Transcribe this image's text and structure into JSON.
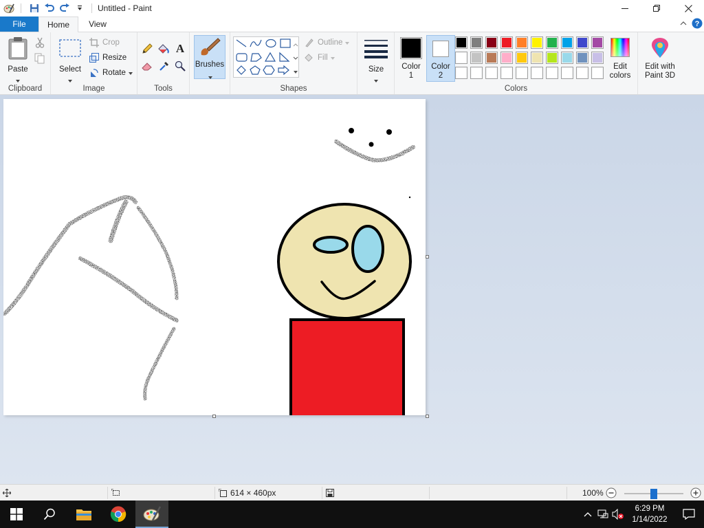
{
  "window": {
    "title": "Untitled - Paint"
  },
  "tabs": {
    "file": "File",
    "home": "Home",
    "view": "View"
  },
  "clipboard": {
    "paste": "Paste",
    "label": "Clipboard"
  },
  "image": {
    "select": "Select",
    "crop": "Crop",
    "resize": "Resize",
    "rotate": "Rotate",
    "label": "Image"
  },
  "tools": {
    "label": "Tools",
    "brushes": "Brushes"
  },
  "shapes": {
    "outline": "Outline",
    "fill": "Fill",
    "label": "Shapes"
  },
  "size": {
    "label": "Size"
  },
  "colors": {
    "color1_label": "Color",
    "color1_num": "1",
    "color2_label": "Color",
    "color2_num": "2",
    "color1_value": "#000000",
    "color2_value": "#ffffff",
    "edit_colors_line1": "Edit",
    "edit_colors_line2": "colors",
    "edit_paint3d_line1": "Edit with",
    "edit_paint3d_line2": "Paint 3D",
    "label": "Colors",
    "palette_row1": [
      "#000000",
      "#7f7f7f",
      "#880015",
      "#ed1c24",
      "#ff7f27",
      "#fff200",
      "#22b14c",
      "#00a2e8",
      "#3f48cc",
      "#a349a4"
    ],
    "palette_row2": [
      "#ffffff",
      "#c3c3c3",
      "#b97a57",
      "#ffaec9",
      "#ffc90e",
      "#efe4b0",
      "#b5e61d",
      "#99d9ea",
      "#7092be",
      "#c8bfe7"
    ],
    "palette_row3": [
      "#ffffff",
      "#ffffff",
      "#ffffff",
      "#ffffff",
      "#ffffff",
      "#ffffff",
      "#ffffff",
      "#ffffff",
      "#ffffff",
      "#ffffff"
    ]
  },
  "drawing": {
    "face_color": "#efe4b0",
    "eye_color": "#99d9ea",
    "shirt_color": "#ed1c24"
  },
  "status": {
    "image_size": "614 × 460px",
    "zoom": "100%",
    "zoom_level": 0.5
  },
  "taskbar": {
    "time": "6:29 PM",
    "date": "1/14/2022"
  }
}
